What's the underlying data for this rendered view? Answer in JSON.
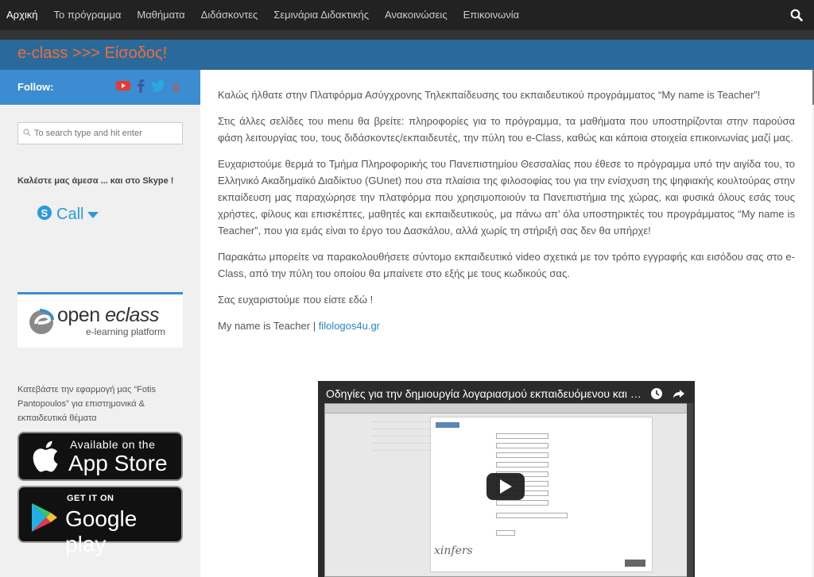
{
  "nav": {
    "items": [
      {
        "label": "Αρχική",
        "active": true
      },
      {
        "label": "Το πρόγραμμα"
      },
      {
        "label": "Μαθήματα"
      },
      {
        "label": "Διδάσκοντες"
      },
      {
        "label": "Σεμινάρια Διδακτικής"
      },
      {
        "label": "Ανακοινώσεις"
      },
      {
        "label": "Επικοινωνία"
      }
    ],
    "search_icon": "search-icon"
  },
  "banner": {
    "title": "e-class >>> Είσοδος!"
  },
  "sidebar": {
    "follow_label": "Follow:",
    "social_icons": [
      "youtube-icon",
      "facebook-icon",
      "twitter-icon",
      "google-plus-icon"
    ],
    "search_placeholder": "To search type and hit enter",
    "skype_heading": "Καλέστε μας άμεσα ... και στο Skype !",
    "skype_call_label": "Call",
    "eclass_logo": {
      "brand_a": "open ",
      "brand_b": "eclass",
      "sub": "e-learning platform"
    },
    "app_text": "Κατεβάστε την εφαρμογή μας “Fotis Pantopoulos” για επιστημονικά & εκπαιδευτικά θέματα",
    "appstore": {
      "small": "Available on the",
      "big": "App Store"
    },
    "gplay": {
      "small": "GET IT ON",
      "big": "Google play"
    }
  },
  "main": {
    "paragraphs": [
      "Καλώς ήλθατε στην Πλατφόρμα Ασύγχρονης Τηλεκπαίδευσης του εκπαιδευτικού προγράμματος “My name is Teacher”!",
      "Στις άλλες σελίδες του menu θα βρείτε: πληροφορίες για το πρόγραμμα, τα μαθήματα που υποστηρίζονται στην παρούσα φάση λειτουργίας του, τους διδάσκοντες/εκπαιδευτές, την πύλη του e-Class, καθώς και κάποια στοιχεία επικοινωνίας μαζί μας.",
      "Ευχαριστούμε θερμά το Τμήμα Πληροφορικής του Πανεπιστημίου Θεσσαλίας που έθεσε το πρόγραμμα υπό την αιγίδα του, το Ελληνικό Ακαδημαϊκό Διαδίκτυο (GUnet) που στα πλαίσια της φιλοσοφίας του για την ενίσχυση της ψηφιακής κουλτούρας στην εκπαίδευση μας παραχώρησε την πλατφόρμα που χρησιμοποιούν τα Πανεπιστήμια της χώρας, και φυσικά όλους εσάς τους χρήστες, φίλους και επισκέπτες, μαθητές και εκπαιδευτικούς, μα πάνω απ’ όλα υποστηρικτές του προγράμματος “My name is Teacher”, που για εμάς είναι το έργο του Δασκάλου, αλλά χωρίς τη στήριξή σας δεν θα υπήρχε!",
      "Παρακάτω μπορείτε να παρακολουθήσετε σύντομο εκπαιδευτικό video σχετικά με τον τρόπο εγγραφής και εισόδου σας στο e-Class, από την πύλη του οποίου θα μπαίνετε στο εξής με τους κωδικούς σας.",
      "Σας ευχαριστούμε που είστε εδώ !"
    ],
    "signature_text": "My name is Teacher | ",
    "signature_link": "filologos4u.gr",
    "video": {
      "title": "Οδηγίες για την δημιουργία λογαριασμού εκπαιδευόμενου και εί...",
      "captcha_text": "xinfers"
    }
  },
  "colors": {
    "nav_bg": "#222222",
    "banner_bg": "#2a6a9a",
    "title_color": "#f26b3a",
    "follow_bg": "#3b8cd0",
    "link": "#2a85c8"
  }
}
